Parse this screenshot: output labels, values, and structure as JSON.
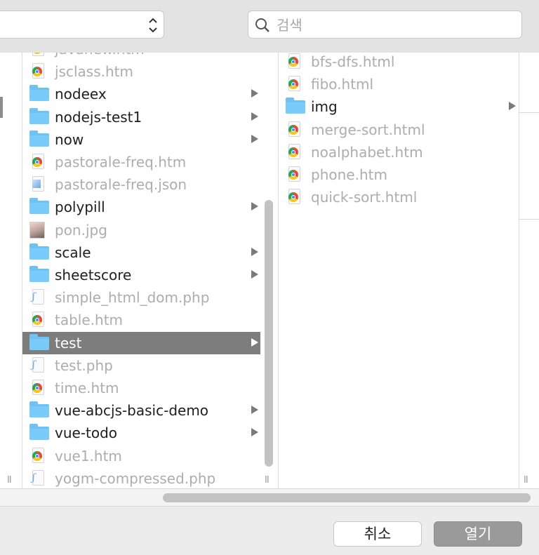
{
  "search": {
    "placeholder": "검색"
  },
  "column2": {
    "items": [
      {
        "name": "javanew.htm",
        "type": "chrome"
      },
      {
        "name": "jsclass.htm",
        "type": "chrome"
      },
      {
        "name": "nodeex",
        "type": "folder"
      },
      {
        "name": "nodejs-test1",
        "type": "folder"
      },
      {
        "name": "now",
        "type": "folder"
      },
      {
        "name": "pastorale-freq.htm",
        "type": "chrome"
      },
      {
        "name": "pastorale-freq.json",
        "type": "json"
      },
      {
        "name": "polypill",
        "type": "folder"
      },
      {
        "name": "pon.jpg",
        "type": "jpg"
      },
      {
        "name": "scale",
        "type": "folder"
      },
      {
        "name": "sheetscore",
        "type": "folder"
      },
      {
        "name": "simple_html_dom.php",
        "type": "php"
      },
      {
        "name": "table.htm",
        "type": "chrome"
      },
      {
        "name": "test",
        "type": "folder",
        "selected": true
      },
      {
        "name": "test.php",
        "type": "php"
      },
      {
        "name": "time.htm",
        "type": "chrome"
      },
      {
        "name": "vue-abcjs-basic-demo",
        "type": "folder"
      },
      {
        "name": "vue-todo",
        "type": "folder"
      },
      {
        "name": "vue1.htm",
        "type": "chrome"
      },
      {
        "name": "yogm-compressed.php",
        "type": "php"
      }
    ]
  },
  "column3": {
    "items": [
      {
        "name": "bfs-dfs.html",
        "type": "chrome"
      },
      {
        "name": "fibo.html",
        "type": "chrome"
      },
      {
        "name": "img",
        "type": "folder"
      },
      {
        "name": "merge-sort.html",
        "type": "chrome"
      },
      {
        "name": "noalphabet.htm",
        "type": "chrome"
      },
      {
        "name": "phone.htm",
        "type": "chrome"
      },
      {
        "name": "quick-sort.html",
        "type": "chrome"
      }
    ]
  },
  "buttons": {
    "cancel": "취소",
    "open": "열기"
  }
}
